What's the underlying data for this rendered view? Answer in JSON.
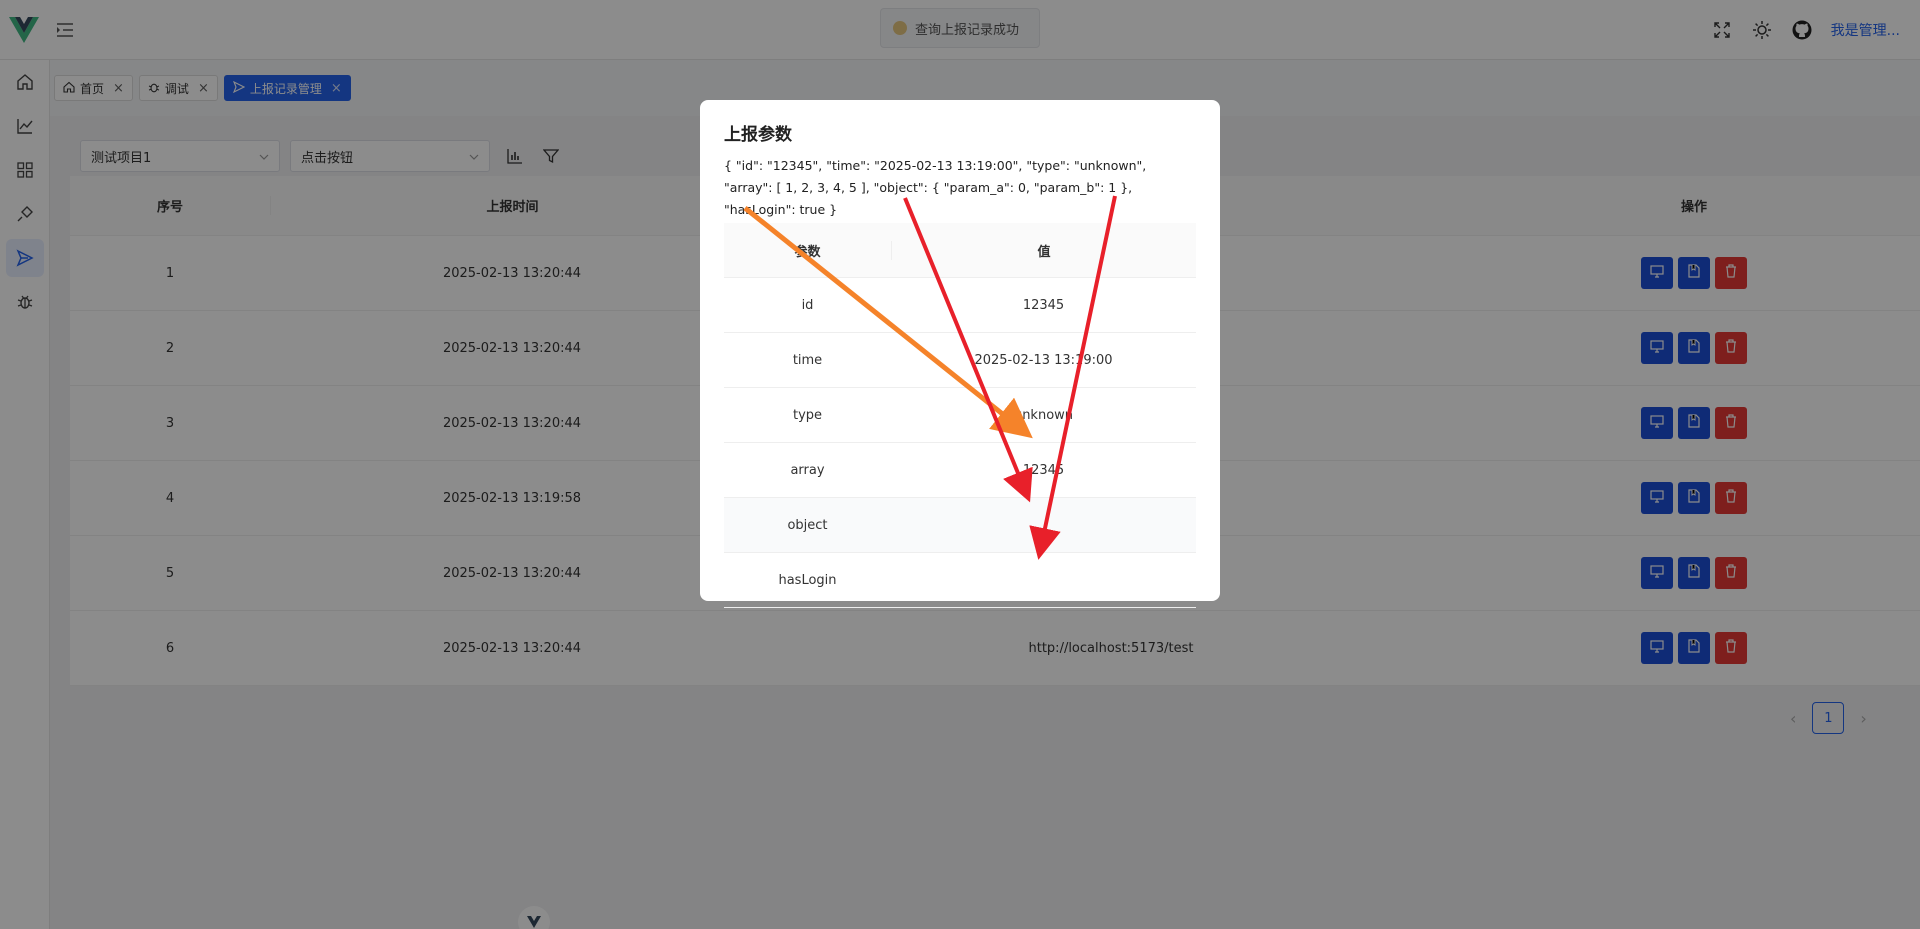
{
  "header": {
    "toast_text": "查询上报记录成功",
    "user_name": "我是管理..."
  },
  "tabs": [
    {
      "label": "首页",
      "close": "×"
    },
    {
      "label": "调试",
      "close": "×"
    },
    {
      "label": "上报记录管理",
      "close": "×"
    }
  ],
  "filters": {
    "project": "测试项目1",
    "event": "点击按钮"
  },
  "table": {
    "headers": [
      "序号",
      "上报时间",
      "",
      "操作"
    ],
    "rows": [
      {
        "index": "1",
        "time": "2025-02-13 13:20:44",
        "url": ""
      },
      {
        "index": "2",
        "time": "2025-02-13 13:20:44",
        "url": ""
      },
      {
        "index": "3",
        "time": "2025-02-13 13:20:44",
        "url": ""
      },
      {
        "index": "4",
        "time": "2025-02-13 13:19:58",
        "url": ""
      },
      {
        "index": "5",
        "time": "2025-02-13 13:20:44",
        "url": ""
      },
      {
        "index": "6",
        "time": "2025-02-13 13:20:44",
        "url": "http://localhost:5173/test"
      }
    ]
  },
  "pagination": {
    "prev": "‹",
    "current": "1",
    "next": "›"
  },
  "modal": {
    "title": "上报参数",
    "json_text": "{ \"id\": \"12345\", \"time\": \"2025-02-13 13:19:00\", \"type\": \"unknown\", \"array\": [ 1, 2, 3, 4, 5 ], \"object\": { \"param_a\": 0, \"param_b\": 1 }, \"hasLogin\": true }",
    "col_key": "参数",
    "col_value": "值",
    "params": [
      {
        "key": "id",
        "value": "12345"
      },
      {
        "key": "time",
        "value": "2025-02-13 13:19:00"
      },
      {
        "key": "type",
        "value": "unknown"
      },
      {
        "key": "array",
        "value": "12345"
      },
      {
        "key": "object",
        "value": ""
      },
      {
        "key": "hasLogin",
        "value": ""
      }
    ]
  },
  "colors": {
    "primary": "#2563eb",
    "action_blue": "#1d4fd8",
    "danger": "#e53935",
    "arrow_orange": "#f5832a",
    "arrow_red": "#e8202a"
  }
}
